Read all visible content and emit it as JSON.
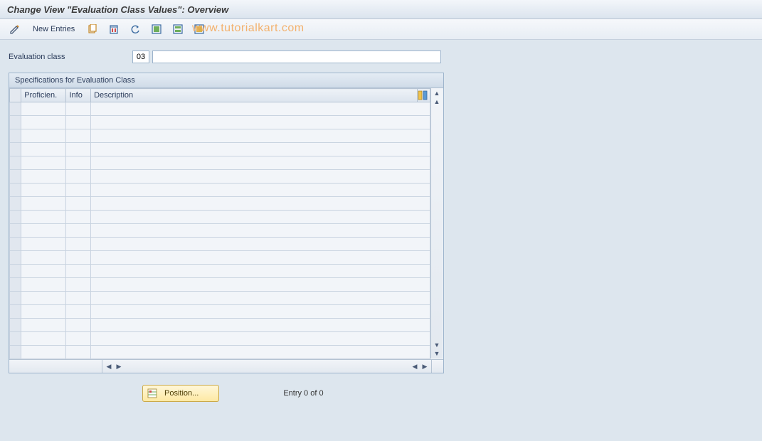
{
  "title": "Change View \"Evaluation Class Values\": Overview",
  "toolbar": {
    "new_entries_label": "New Entries"
  },
  "watermark": "www.tutorialkart.com",
  "field": {
    "label": "Evaluation class",
    "value": "03",
    "description": ""
  },
  "panel": {
    "title": "Specifications for Evaluation Class",
    "columns": {
      "proficiency": "Proficien.",
      "info": "Info",
      "description": "Description"
    },
    "row_count": 19
  },
  "footer": {
    "position_label": "Position...",
    "entry_label": "Entry 0 of 0"
  }
}
